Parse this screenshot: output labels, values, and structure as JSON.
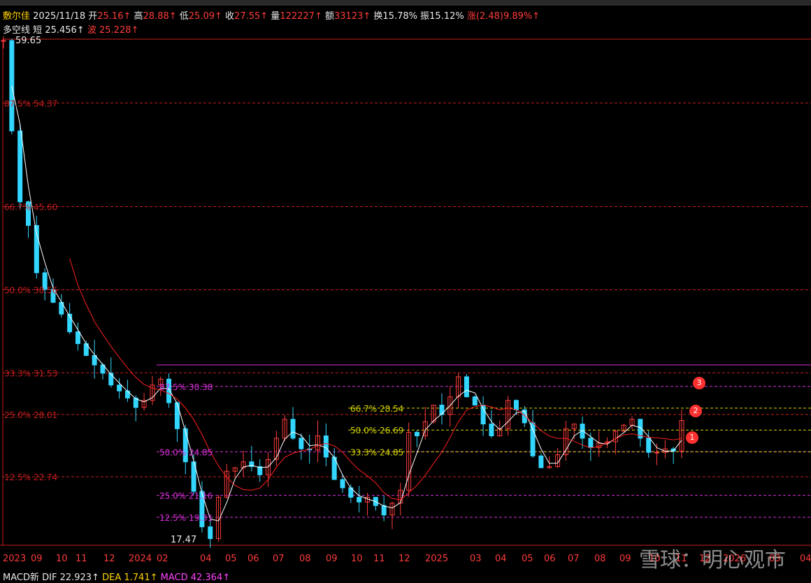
{
  "header": {
    "name": "敷尔佳",
    "date": "2025/11/18",
    "open_label": "开",
    "open": "25.16↑",
    "high_label": "高",
    "high": "28.88↑",
    "low_label": "低",
    "low": "25.09↑",
    "close_label": "收",
    "close": "27.55↑",
    "vol_label": "量",
    "vol": "122227↑",
    "amt_label": "额",
    "amt": "33123↑",
    "turnover_label": "换",
    "turnover": "15.78%",
    "amp_label": "振",
    "amp": "15.12%",
    "chg_label": "涨",
    "chg": "(2.48)9.89%↑"
  },
  "indicator": {
    "name": "多空线",
    "short_label": "短",
    "short_val": "25.456↑",
    "wave_label": "波",
    "wave_val": "25.228↑"
  },
  "macd": {
    "name": "MACD新",
    "dif_label": "DIF",
    "dif": "22.923↑",
    "dea_label": "DEA",
    "dea": "1.741↑",
    "macd_label": "MACD",
    "macd": "42.364↑"
  },
  "watermark": "雪球：明心观市",
  "markers": [
    "1",
    "2",
    "3"
  ],
  "chart_data": {
    "type": "candlestick",
    "price_max": "59.65",
    "price_min": "17.47",
    "ylim": [
      17.0,
      59.65
    ],
    "fib_left": [
      {
        "label": "87.5% 54.37",
        "value": 54.37
      },
      {
        "label": "66.7% 45.60",
        "value": 45.6
      },
      {
        "label": "50.0% 38.56",
        "value": 38.56
      },
      {
        "label": "33.3% 31.53",
        "value": 31.53
      },
      {
        "label": "25.0% 28.01",
        "value": 28.01
      },
      {
        "label": "12.5% 22.74",
        "value": 22.74
      }
    ],
    "fib_magenta": [
      {
        "label": "87.5% 30.38",
        "value": 30.38
      },
      {
        "label": "50.0% 24.85",
        "value": 24.85
      },
      {
        "label": "25.0% 21.16",
        "value": 21.16
      },
      {
        "label": "12.5% 19.31",
        "value": 19.31
      }
    ],
    "fib_yellow": [
      {
        "label": "66.7% 28.54",
        "value": 28.54
      },
      {
        "label": "50.0% 26.69",
        "value": 26.69
      },
      {
        "label": "33.3% 24.85",
        "value": 24.85
      }
    ],
    "range_top_line": 32.2,
    "x_labels": [
      "2023",
      "09",
      "10",
      "11",
      "12",
      "2024",
      "02",
      "04",
      "05",
      "06",
      "07",
      "08",
      "09",
      "10",
      "11",
      "12",
      "2025",
      "03",
      "04",
      "05",
      "06",
      "07",
      "08",
      "09",
      "10",
      "11",
      "12",
      "2026",
      "03",
      "04"
    ],
    "close_series": [
      59.65,
      52,
      46,
      44,
      40,
      38.6,
      37.5,
      36.5,
      35,
      34,
      33,
      32.2,
      31.5,
      30.5,
      30,
      29.4,
      28.6,
      29.2,
      30.5,
      31,
      29,
      26.8,
      24,
      21.5,
      18.5,
      17.5,
      21,
      23.2,
      23.5,
      24,
      23.6,
      22.9,
      24.2,
      26,
      27.6,
      26,
      25.1,
      25,
      26.2,
      24.4,
      22.5,
      21.8,
      21,
      20.6,
      21,
      20.3,
      19.5,
      20.5,
      21.6,
      26.5,
      26.2,
      27.4,
      28.8,
      28,
      29.5,
      31.2,
      29.5,
      28.8,
      27.2,
      26.2,
      26.8,
      29.2,
      28.4,
      27.3,
      24.5,
      23.5,
      23.6,
      24.6,
      26.8,
      27.2,
      26,
      25.2,
      25.6,
      25.7,
      26.6,
      27.1,
      27.6,
      26,
      24.8,
      24.8,
      25.1,
      24.9,
      27.5
    ]
  },
  "colors": {
    "up": "#ff3b3b",
    "down": "#33d6ff",
    "ma_short": "#ffffff",
    "ma_long": "#ff2020",
    "fib_red": "#c81e1e",
    "fib_magenta": "#d62fd6",
    "fib_yellow": "#d6d600"
  }
}
